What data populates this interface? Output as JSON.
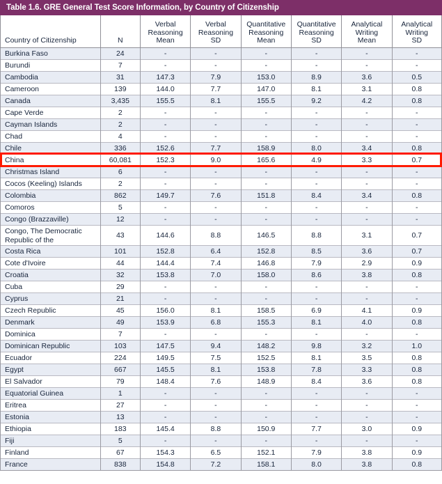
{
  "table": {
    "title": "Table 1.6. GRE General Test Score Information, by Country of Citizenship",
    "accent_color": "#7d2f68",
    "stripe_color": "#e8ecf4",
    "highlight_color": "#ff1a00",
    "highlighted_row": "China",
    "columns": [
      "Country of Citizenship",
      "N",
      "Verbal Reasoning Mean",
      "Verbal Reasoning SD",
      "Quantitative Reasoning Mean",
      "Quantitative Reasoning SD",
      "Analytical Writing Mean",
      "Analytical Writing SD"
    ],
    "column_header_lines": [
      [
        "Country of Citizenship"
      ],
      [
        "N"
      ],
      [
        "Verbal",
        "Reasoning",
        "Mean"
      ],
      [
        "Verbal",
        "Reasoning",
        "SD"
      ],
      [
        "Quantitative",
        "Reasoning",
        "Mean"
      ],
      [
        "Quantitative",
        "Reasoning",
        "SD"
      ],
      [
        "Analytical",
        "Writing",
        "Mean"
      ],
      [
        "Analytical",
        "Writing",
        "SD"
      ]
    ],
    "rows": [
      {
        "country": "Burkina Faso",
        "n": "24",
        "vr_mean": "-",
        "vr_sd": "-",
        "qr_mean": "-",
        "qr_sd": "-",
        "aw_mean": "-",
        "aw_sd": "-"
      },
      {
        "country": "Burundi",
        "n": "7",
        "vr_mean": "-",
        "vr_sd": "-",
        "qr_mean": "-",
        "qr_sd": "-",
        "aw_mean": "-",
        "aw_sd": "-"
      },
      {
        "country": "Cambodia",
        "n": "31",
        "vr_mean": "147.3",
        "vr_sd": "7.9",
        "qr_mean": "153.0",
        "qr_sd": "8.9",
        "aw_mean": "3.6",
        "aw_sd": "0.5"
      },
      {
        "country": "Cameroon",
        "n": "139",
        "vr_mean": "144.0",
        "vr_sd": "7.7",
        "qr_mean": "147.0",
        "qr_sd": "8.1",
        "aw_mean": "3.1",
        "aw_sd": "0.8"
      },
      {
        "country": "Canada",
        "n": "3,435",
        "vr_mean": "155.5",
        "vr_sd": "8.1",
        "qr_mean": "155.5",
        "qr_sd": "9.2",
        "aw_mean": "4.2",
        "aw_sd": "0.8"
      },
      {
        "country": "Cape Verde",
        "n": "2",
        "vr_mean": "-",
        "vr_sd": "-",
        "qr_mean": "-",
        "qr_sd": "-",
        "aw_mean": "-",
        "aw_sd": "-"
      },
      {
        "country": "Cayman Islands",
        "n": "2",
        "vr_mean": "-",
        "vr_sd": "-",
        "qr_mean": "-",
        "qr_sd": "-",
        "aw_mean": "-",
        "aw_sd": "-"
      },
      {
        "country": "Chad",
        "n": "4",
        "vr_mean": "-",
        "vr_sd": "-",
        "qr_mean": "-",
        "qr_sd": "-",
        "aw_mean": "-",
        "aw_sd": "-"
      },
      {
        "country": "Chile",
        "n": "336",
        "vr_mean": "152.6",
        "vr_sd": "7.7",
        "qr_mean": "158.9",
        "qr_sd": "8.0",
        "aw_mean": "3.4",
        "aw_sd": "0.8"
      },
      {
        "country": "China",
        "n": "60,081",
        "vr_mean": "152.3",
        "vr_sd": "9.0",
        "qr_mean": "165.6",
        "qr_sd": "4.9",
        "aw_mean": "3.3",
        "aw_sd": "0.7"
      },
      {
        "country": "Christmas Island",
        "n": "6",
        "vr_mean": "-",
        "vr_sd": "-",
        "qr_mean": "-",
        "qr_sd": "-",
        "aw_mean": "-",
        "aw_sd": "-"
      },
      {
        "country": "Cocos (Keeling) Islands",
        "n": "2",
        "vr_mean": "-",
        "vr_sd": "-",
        "qr_mean": "-",
        "qr_sd": "-",
        "aw_mean": "-",
        "aw_sd": "-"
      },
      {
        "country": "Colombia",
        "n": "862",
        "vr_mean": "149.7",
        "vr_sd": "7.6",
        "qr_mean": "151.8",
        "qr_sd": "8.4",
        "aw_mean": "3.4",
        "aw_sd": "0.8"
      },
      {
        "country": "Comoros",
        "n": "5",
        "vr_mean": "-",
        "vr_sd": "-",
        "qr_mean": "-",
        "qr_sd": "-",
        "aw_mean": "-",
        "aw_sd": "-"
      },
      {
        "country": "Congo (Brazzaville)",
        "n": "12",
        "vr_mean": "-",
        "vr_sd": "-",
        "qr_mean": "-",
        "qr_sd": "-",
        "aw_mean": "-",
        "aw_sd": "-"
      },
      {
        "country": "Congo, The Democratic Republic of the",
        "n": "43",
        "vr_mean": "144.6",
        "vr_sd": "8.8",
        "qr_mean": "146.5",
        "qr_sd": "8.8",
        "aw_mean": "3.1",
        "aw_sd": "0.7",
        "tall": true
      },
      {
        "country": "Costa Rica",
        "n": "101",
        "vr_mean": "152.8",
        "vr_sd": "6.4",
        "qr_mean": "152.8",
        "qr_sd": "8.5",
        "aw_mean": "3.6",
        "aw_sd": "0.7"
      },
      {
        "country": "Cote d'Ivoire",
        "n": "44",
        "vr_mean": "144.4",
        "vr_sd": "7.4",
        "qr_mean": "146.8",
        "qr_sd": "7.9",
        "aw_mean": "2.9",
        "aw_sd": "0.9"
      },
      {
        "country": "Croatia",
        "n": "32",
        "vr_mean": "153.8",
        "vr_sd": "7.0",
        "qr_mean": "158.0",
        "qr_sd": "8.6",
        "aw_mean": "3.8",
        "aw_sd": "0.8"
      },
      {
        "country": "Cuba",
        "n": "29",
        "vr_mean": "-",
        "vr_sd": "-",
        "qr_mean": "-",
        "qr_sd": "-",
        "aw_mean": "-",
        "aw_sd": "-"
      },
      {
        "country": "Cyprus",
        "n": "21",
        "vr_mean": "-",
        "vr_sd": "-",
        "qr_mean": "-",
        "qr_sd": "-",
        "aw_mean": "-",
        "aw_sd": "-"
      },
      {
        "country": "Czech Republic",
        "n": "45",
        "vr_mean": "156.0",
        "vr_sd": "8.1",
        "qr_mean": "158.5",
        "qr_sd": "6.9",
        "aw_mean": "4.1",
        "aw_sd": "0.9"
      },
      {
        "country": "Denmark",
        "n": "49",
        "vr_mean": "153.9",
        "vr_sd": "6.8",
        "qr_mean": "155.3",
        "qr_sd": "8.1",
        "aw_mean": "4.0",
        "aw_sd": "0.8"
      },
      {
        "country": "Dominica",
        "n": "7",
        "vr_mean": "-",
        "vr_sd": "-",
        "qr_mean": "-",
        "qr_sd": "-",
        "aw_mean": "-",
        "aw_sd": "-"
      },
      {
        "country": "Dominican Republic",
        "n": "103",
        "vr_mean": "147.5",
        "vr_sd": "9.4",
        "qr_mean": "148.2",
        "qr_sd": "9.8",
        "aw_mean": "3.2",
        "aw_sd": "1.0"
      },
      {
        "country": "Ecuador",
        "n": "224",
        "vr_mean": "149.5",
        "vr_sd": "7.5",
        "qr_mean": "152.5",
        "qr_sd": "8.1",
        "aw_mean": "3.5",
        "aw_sd": "0.8"
      },
      {
        "country": "Egypt",
        "n": "667",
        "vr_mean": "145.5",
        "vr_sd": "8.1",
        "qr_mean": "153.8",
        "qr_sd": "7.8",
        "aw_mean": "3.3",
        "aw_sd": "0.8"
      },
      {
        "country": "El Salvador",
        "n": "79",
        "vr_mean": "148.4",
        "vr_sd": "7.6",
        "qr_mean": "148.9",
        "qr_sd": "8.4",
        "aw_mean": "3.6",
        "aw_sd": "0.8"
      },
      {
        "country": "Equatorial Guinea",
        "n": "1",
        "vr_mean": "-",
        "vr_sd": "-",
        "qr_mean": "-",
        "qr_sd": "-",
        "aw_mean": "-",
        "aw_sd": "-"
      },
      {
        "country": "Eritrea",
        "n": "27",
        "vr_mean": "-",
        "vr_sd": "-",
        "qr_mean": "-",
        "qr_sd": "-",
        "aw_mean": "-",
        "aw_sd": "-"
      },
      {
        "country": "Estonia",
        "n": "13",
        "vr_mean": "-",
        "vr_sd": "-",
        "qr_mean": "-",
        "qr_sd": "-",
        "aw_mean": "-",
        "aw_sd": "-"
      },
      {
        "country": "Ethiopia",
        "n": "183",
        "vr_mean": "145.4",
        "vr_sd": "8.8",
        "qr_mean": "150.9",
        "qr_sd": "7.7",
        "aw_mean": "3.0",
        "aw_sd": "0.9"
      },
      {
        "country": "Fiji",
        "n": "5",
        "vr_mean": "-",
        "vr_sd": "-",
        "qr_mean": "-",
        "qr_sd": "-",
        "aw_mean": "-",
        "aw_sd": "-"
      },
      {
        "country": "Finland",
        "n": "67",
        "vr_mean": "154.3",
        "vr_sd": "6.5",
        "qr_mean": "152.1",
        "qr_sd": "7.9",
        "aw_mean": "3.8",
        "aw_sd": "0.9"
      },
      {
        "country": "France",
        "n": "838",
        "vr_mean": "154.8",
        "vr_sd": "7.2",
        "qr_mean": "158.1",
        "qr_sd": "8.0",
        "aw_mean": "3.8",
        "aw_sd": "0.8"
      }
    ]
  }
}
